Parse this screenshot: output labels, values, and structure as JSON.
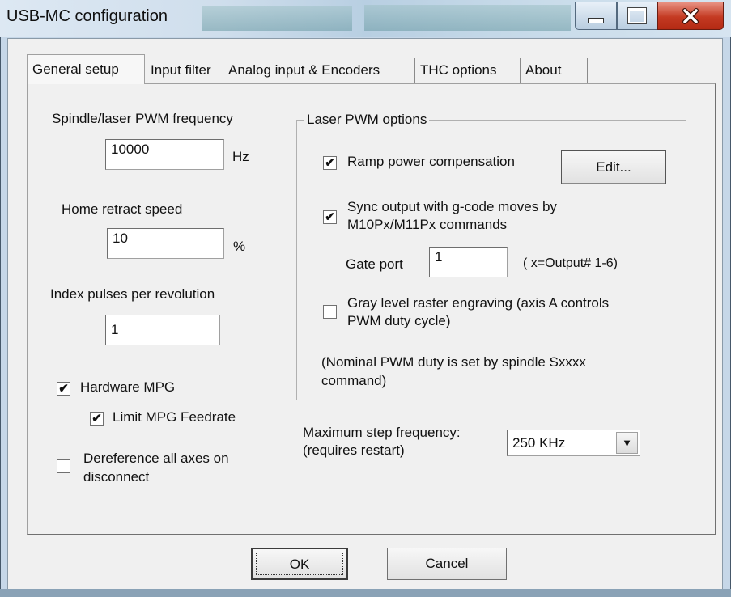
{
  "window": {
    "title": "USB-MC configuration",
    "controls": {
      "minimize": "minimize-icon",
      "maximize": "maximize-icon",
      "close": "close-icon"
    }
  },
  "tabs": [
    {
      "label": "General setup",
      "active": true
    },
    {
      "label": "Input filter",
      "active": false
    },
    {
      "label": "Analog input & Encoders",
      "active": false
    },
    {
      "label": "THC options",
      "active": false
    },
    {
      "label": "About",
      "active": false
    }
  ],
  "general": {
    "pwm_freq": {
      "label": "Spindle/laser PWM frequency",
      "value": "10000",
      "unit": "Hz"
    },
    "home_retract": {
      "label": "Home retract speed",
      "value": "10",
      "unit": "%"
    },
    "index_pulses": {
      "label": "Index pulses per revolution",
      "value": "1"
    },
    "hardware_mpg": {
      "label": "Hardware MPG",
      "checked": true
    },
    "limit_mpg": {
      "label": "Limit MPG Feedrate",
      "checked": true
    },
    "dereference": {
      "line1": "Dereference all axes on",
      "line2": "disconnect",
      "checked": false
    }
  },
  "laser": {
    "group_title": "Laser PWM options",
    "ramp": {
      "label": "Ramp power compensation",
      "checked": true
    },
    "edit_button": "Edit...",
    "sync": {
      "line1": "Sync output with g-code moves by",
      "line2": "M10Px/M11Px commands",
      "checked": true
    },
    "gate_port": {
      "label": "Gate port",
      "value": "1",
      "hint": "( x=Output# 1-6)"
    },
    "gray": {
      "line1": "Gray level raster engraving (axis A controls",
      "line2": "PWM duty cycle)",
      "checked": false
    },
    "note": {
      "line1": "(Nominal PWM duty is set by spindle Sxxxx",
      "line2": "command)"
    }
  },
  "step_freq": {
    "label_line1": "Maximum step frequency:",
    "label_line2": "(requires restart)",
    "selected": "250 KHz"
  },
  "footer": {
    "ok": "OK",
    "cancel": "Cancel"
  },
  "checkmark": "✔",
  "dropdown_arrow": "▼"
}
